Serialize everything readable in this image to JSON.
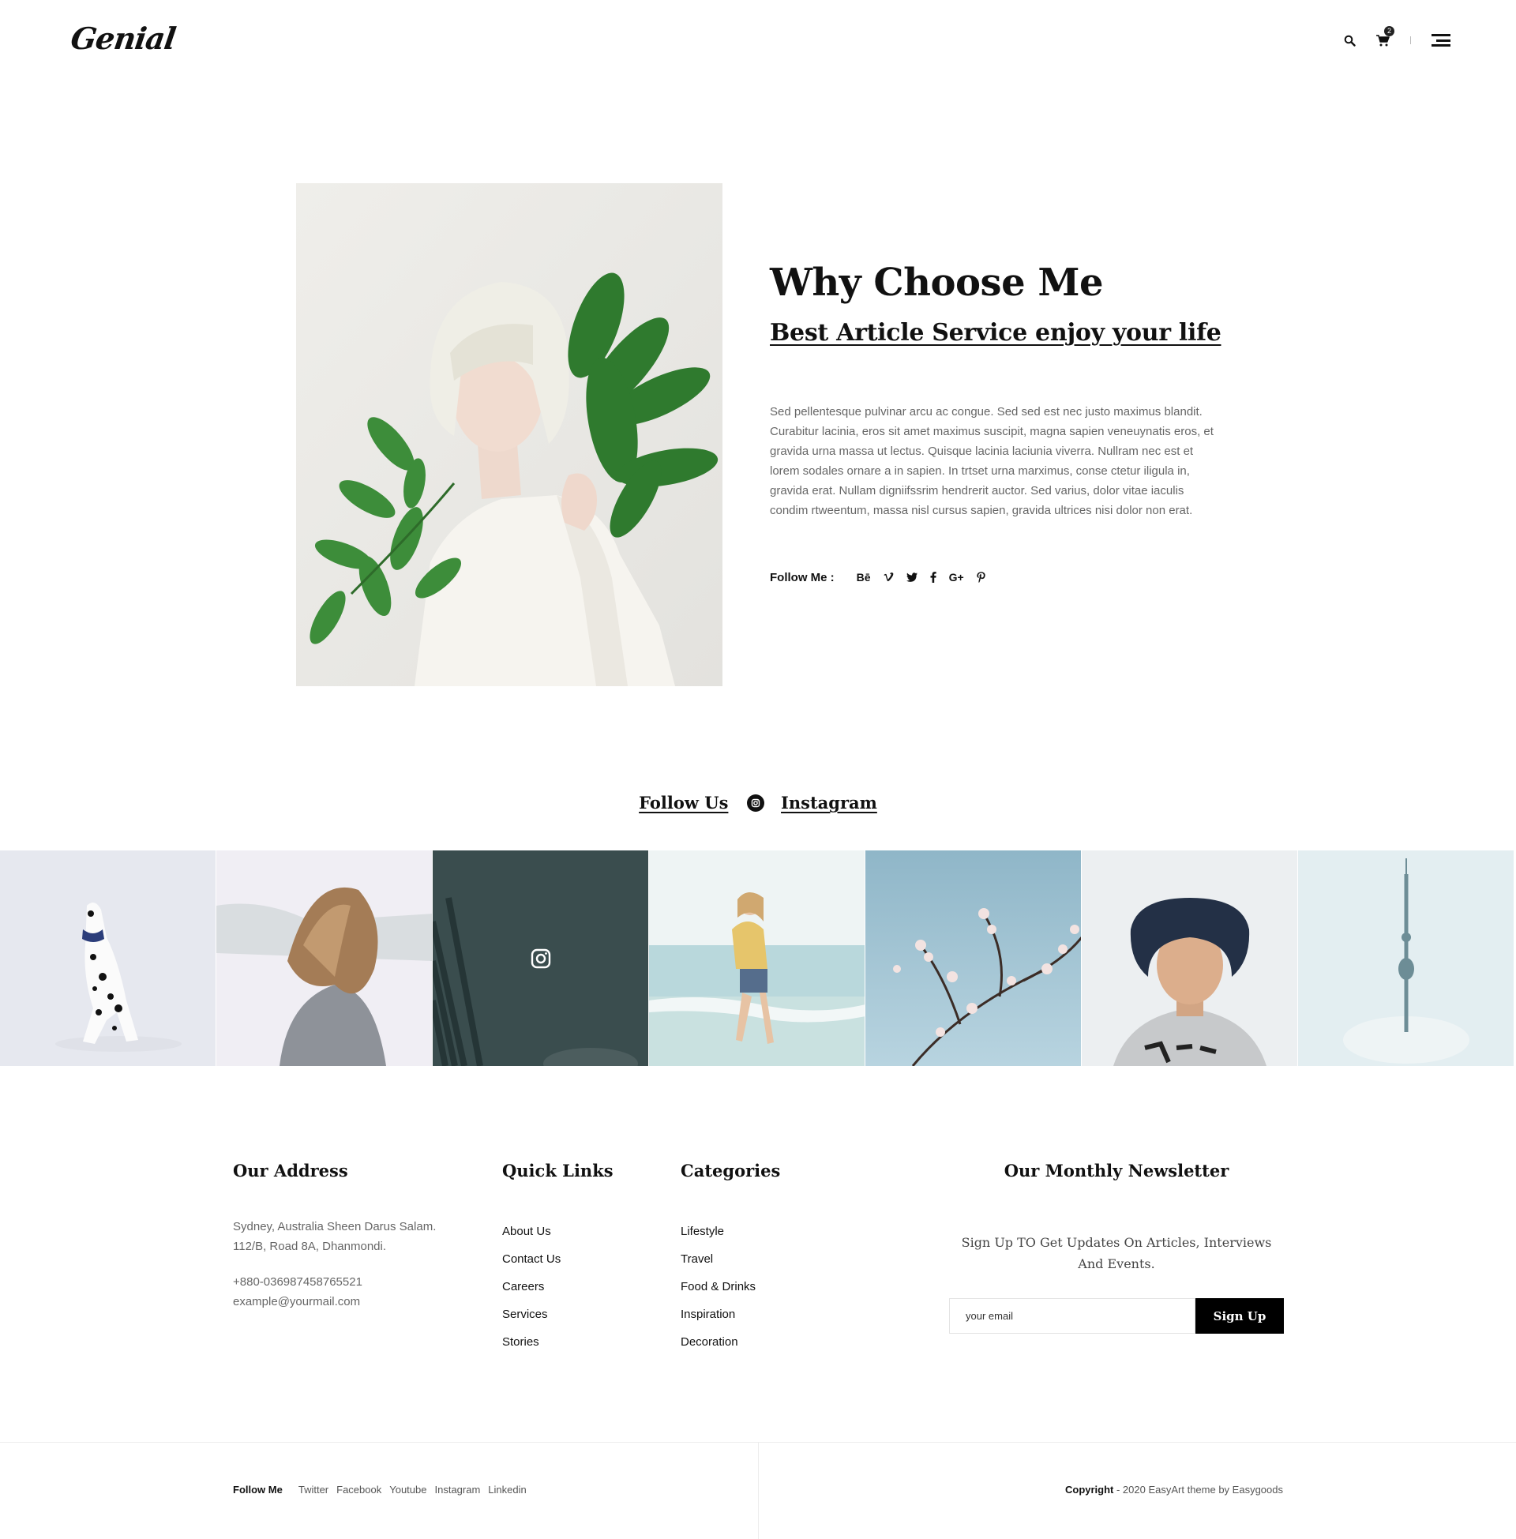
{
  "header": {
    "logo": "Genial",
    "cart_count": "2",
    "icons": [
      "search-icon",
      "cart-icon",
      "menu-icon"
    ]
  },
  "about": {
    "title": "Why Choose Me",
    "subtitle": "Best Article Service enjoy your life",
    "body": "Sed pellentesque pulvinar arcu ac congue. Sed sed est nec justo maximus blandit. Curabitur lacinia, eros sit amet maximus suscipit, magna sapien veneuynatis eros, et gravida urna massa ut lectus. Quisque lacinia laciunia viverra. Nullram nec est et lorem sodales ornare a in sapien. In trtset urna marximus, conse ctetur iligula in, gravida erat. Nullam digniifssrim hendrerit auctor. Sed varius, dolor vitae iaculis condim rtweentum, massa nisl cursus sapien, gravida ultrices nisi dolor non erat.",
    "follow_label": "Follow Me :",
    "social": [
      {
        "name": "behance-icon",
        "glyph": "Bē"
      },
      {
        "name": "vimeo-icon",
        "glyph": "v"
      },
      {
        "name": "twitter-icon",
        "glyph": "t"
      },
      {
        "name": "facebook-icon",
        "glyph": "f"
      },
      {
        "name": "google-plus-icon",
        "glyph": "G+"
      },
      {
        "name": "pinterest-icon",
        "glyph": "p"
      }
    ]
  },
  "instagram": {
    "follow_text": "Follow Us",
    "instagram_text": "Instagram"
  },
  "footer": {
    "address": {
      "title": "Our Address",
      "line1": "Sydney, Australia Sheen Darus Salam.",
      "line2": "112/B, Road 8A, Dhanmondi.",
      "phone": "+880-036987458765521",
      "email": "example@yourmail.com"
    },
    "quick_links": {
      "title": "Quick Links",
      "items": [
        "About Us",
        "Contact Us",
        "Careers",
        "Services",
        "Stories"
      ]
    },
    "categories": {
      "title": "Categories",
      "items": [
        "Lifestyle",
        "Travel",
        "Food & Drinks",
        "Inspiration",
        "Decoration"
      ]
    },
    "newsletter": {
      "title": "Our Monthly Newsletter",
      "text": "Sign Up TO Get Updates On Articles, Interviews And Events.",
      "placeholder": "your email",
      "button": "Sign Up"
    }
  },
  "bottom": {
    "follow_label": "Follow Me",
    "links": [
      "Twitter",
      "Facebook",
      "Youtube",
      "Instagram",
      "Linkedin"
    ],
    "copyright_bold": "Copyright",
    "copyright_rest": " - 2020 EasyArt theme by Easygoods"
  }
}
